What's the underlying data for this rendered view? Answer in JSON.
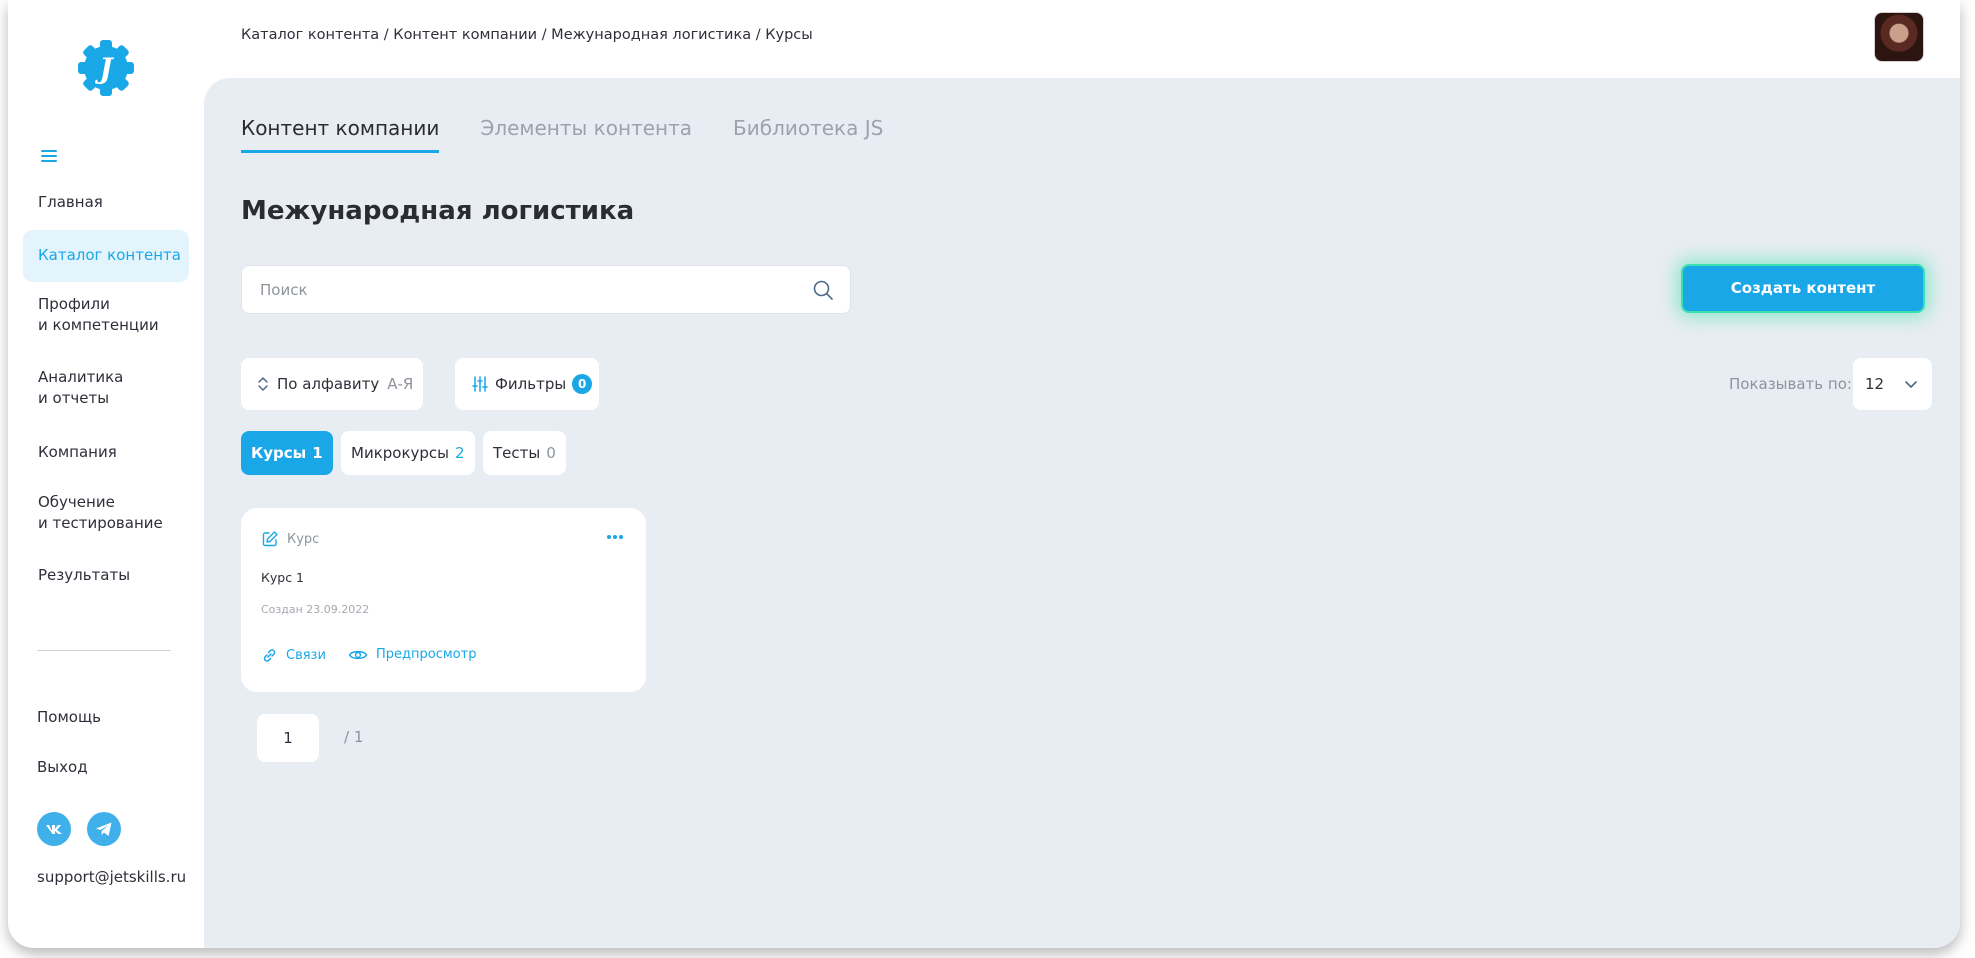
{
  "breadcrumb": "Каталог контента / Контент компании / Межународная логистика / Курсы",
  "sidebar": {
    "items": [
      {
        "line1": "Главная",
        "line2": ""
      },
      {
        "line1": "Каталог контента",
        "line2": ""
      },
      {
        "line1": "Профили",
        "line2": "и компетенции"
      },
      {
        "line1": "Аналитика",
        "line2": "и отчеты"
      },
      {
        "line1": "Компания",
        "line2": ""
      },
      {
        "line1": "Обучение",
        "line2": "и тестирование"
      },
      {
        "line1": "Результаты",
        "line2": ""
      }
    ],
    "help": "Помощь",
    "logout": "Выход",
    "support_email": "support@jetskills.ru"
  },
  "tabs": [
    {
      "label": "Контент компании"
    },
    {
      "label": "Элементы контента"
    },
    {
      "label": "Библиотека JS"
    }
  ],
  "page_title": "Межунарoдная логистика",
  "search": {
    "placeholder": "Поиск"
  },
  "create_button": "Создать контент",
  "sort": {
    "label": "По алфавиту",
    "order": "А-Я"
  },
  "filters": {
    "label": "Фильтры",
    "count": "0"
  },
  "show": {
    "label": "Показывать по:",
    "value": "12"
  },
  "chips": [
    {
      "label": "Курсы",
      "count": "1"
    },
    {
      "label": "Микрокурсы",
      "count": "2"
    },
    {
      "label": "Тесты",
      "count": "0"
    }
  ],
  "card": {
    "type": "Курс",
    "title": "Курс 1",
    "date": "Создан 23.09.2022",
    "links_label": "Связи",
    "preview_label": "Предпросмотр"
  },
  "pagination": {
    "current": "1",
    "total": "/ 1"
  },
  "colors": {
    "accent": "#1aa7e8",
    "panel": "#e8edf3",
    "glow": "#3be0b0"
  }
}
